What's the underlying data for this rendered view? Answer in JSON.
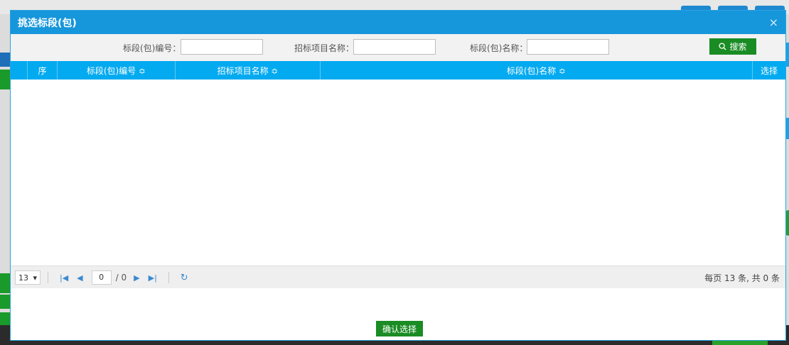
{
  "dialog": {
    "title": "挑选标段(包)",
    "close_symbol": "×"
  },
  "search": {
    "code_label": "标段(包)编号：",
    "project_label": "招标项目名称：",
    "name_label": "标段(包)名称：",
    "code_value": "",
    "project_value": "",
    "name_value": "",
    "search_button": "搜索",
    "search_icon": "search-icon"
  },
  "grid": {
    "columns": [
      "序",
      "标段(包)编号 ≎",
      "招标项目名称 ≎",
      "标段(包)名称 ≎",
      "选择"
    ],
    "rows": []
  },
  "pager": {
    "page_size": "13",
    "current_page": "0",
    "total_pages": "/ 0",
    "info": "每页 13 条, 共 0 条"
  },
  "footer": {
    "confirm_button": "确认选择"
  },
  "colors": {
    "header": "#1696db",
    "grid_header": "#04aaf0",
    "button": "#1a8c24"
  }
}
